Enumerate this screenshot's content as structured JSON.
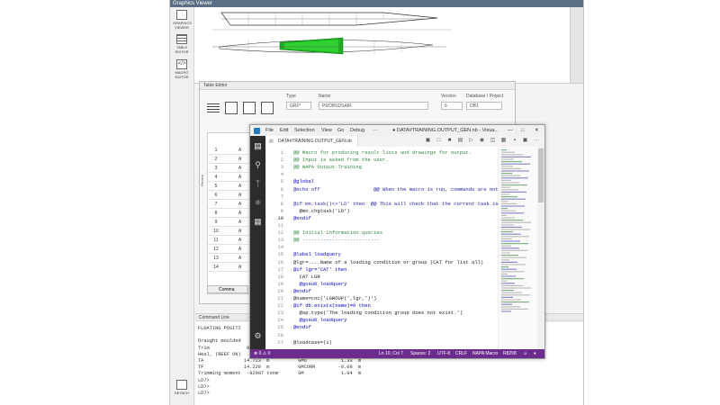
{
  "graphics_viewer": {
    "title": "Graphics Viewer"
  },
  "left_toolbar": {
    "items": [
      {
        "label": "GRAPHICS VIEWER",
        "icon": "chart-icon"
      },
      {
        "label": "TABLE EDITOR",
        "icon": "table-icon"
      },
      {
        "label": "MACRO EDITOR",
        "icon": "code-icon"
      }
    ],
    "bottom_label": "DETACH"
  },
  "table_editor": {
    "title": "Table Editor",
    "fields": {
      "type_label": "Type",
      "type_value": "GRF*",
      "name_label": "Name",
      "name_value": "PROBSDSAIR",
      "version_label": "Version",
      "version_value": "6",
      "db_label": "Database / Project",
      "db_value": "DB1"
    },
    "recent_label": "Recent",
    "rows": [
      {
        "n": "1",
        "a": "A"
      },
      {
        "n": "2",
        "a": "A"
      },
      {
        "n": "3",
        "a": "A"
      },
      {
        "n": "4",
        "a": "A"
      },
      {
        "n": "5",
        "a": "A"
      },
      {
        "n": "6",
        "a": "A"
      },
      {
        "n": "7",
        "a": "A"
      },
      {
        "n": "8",
        "a": "A"
      },
      {
        "n": "9",
        "a": "A"
      },
      {
        "n": "10",
        "a": "A"
      },
      {
        "n": "11",
        "a": "A"
      },
      {
        "n": "12",
        "a": "A"
      },
      {
        "n": "13",
        "a": "A"
      },
      {
        "n": "14",
        "a": "A"
      }
    ],
    "command_tab": "Comma"
  },
  "command_line": {
    "title": "Command Line",
    "lines": [
      "FLOATING POSITI",
      "",
      "Draught moulded",
      "Trim             0.503  m          KG            20.31  m",
      "Heel, (REEF ON)    0.0  deg",
      "TA              14.723  m          GMO            1.33  m",
      "TF              14.220  m          GMCORR        -0.09  m",
      "Trimming moment  -92907 tonm       GM             1.04  m",
      "LD7>",
      "LD7>",
      "LD7>"
    ]
  },
  "vscode": {
    "menu": [
      "File",
      "Edit",
      "Selection",
      "View",
      "Go",
      "Debug",
      "···"
    ],
    "window_title": "● DATA#TRAINING.OUTPUT_GEN.nb - Visua...",
    "tab_label": "DATA#TRAINING.OUTPUT_GEN.nb",
    "lines": [
      {
        "n": "1",
        "t": "@@ Macro for producing result lists and drawings for output.",
        "c": "cm"
      },
      {
        "n": "2",
        "t": "@@ Input is asked from the user.",
        "c": "cm"
      },
      {
        "n": "3",
        "t": "@@ NAPA Output Training",
        "c": "cm"
      },
      {
        "n": "4",
        "t": "",
        "c": ""
      },
      {
        "n": "5",
        "t": "@global",
        "c": "kw"
      },
      {
        "n": "6",
        "t": "@echo off                  @@ When the macro is run, commands are not pr",
        "c": "mix"
      },
      {
        "n": "7",
        "t": "",
        "c": ""
      },
      {
        "n": "8",
        "t": "@if mn.task()<>'LD' then  @@ This will check that the current task is L",
        "c": "mix"
      },
      {
        "n": "9",
        "t": "  @mn.chgtask('LD')",
        "c": ""
      },
      {
        "n": "10",
        "t": "@endif",
        "c": "kw"
      },
      {
        "n": "11",
        "t": "",
        "c": ""
      },
      {
        "n": "12",
        "t": "@@ Initial information queries",
        "c": "cm"
      },
      {
        "n": "13",
        "t": "@@ --------------------------",
        "c": "cm"
      },
      {
        "n": "14",
        "t": "",
        "c": ""
      },
      {
        "n": "15",
        "t": "@label loadquery",
        "c": "kw"
      },
      {
        "n": "16",
        "t": "@lgr=....Name of a loading condition or group (CAT for list all)",
        "c": ""
      },
      {
        "n": "17",
        "t": "@if lgr='CAT' then",
        "c": "kw"
      },
      {
        "n": "18",
        "t": "  CAT LGR",
        "c": ""
      },
      {
        "n": "19",
        "t": "  @gosub loadquery",
        "c": "kw"
      },
      {
        "n": "20",
        "t": "@endif",
        "c": "kw"
      },
      {
        "n": "21",
        "t": "@name=cnc('LGROUP(',lgr,')')",
        "c": ""
      },
      {
        "n": "22",
        "t": "@if db.exists(name)=0 then",
        "c": "kw"
      },
      {
        "n": "23",
        "t": "  @ap.type('The loading condition group does not exist.')",
        "c": ""
      },
      {
        "n": "24",
        "t": "  @gosub loadquery",
        "c": "kw"
      },
      {
        "n": "25",
        "t": "@endif",
        "c": "kw"
      },
      {
        "n": "26",
        "t": "",
        "c": ""
      },
      {
        "n": "27",
        "t": "@loadcase=(1)",
        "c": ""
      }
    ],
    "status": {
      "errors": "⊗ 0 ⚠ 0",
      "position": "Ln 10, Col 7",
      "spaces": "Spaces: 2",
      "encoding": "UTF-8",
      "eol": "CRLF",
      "language": "NAPA Macro",
      "build": "R8298"
    }
  }
}
